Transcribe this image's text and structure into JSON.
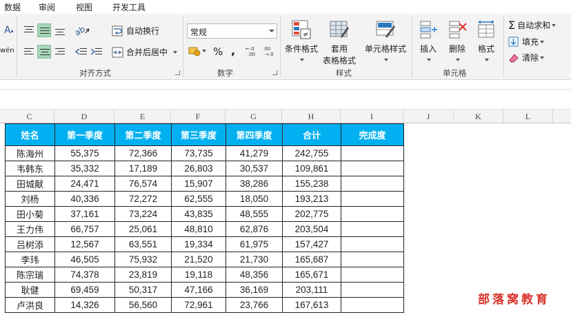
{
  "menu": {
    "tabs": [
      "数据",
      "审阅",
      "视图",
      "开发工具"
    ]
  },
  "ribbon": {
    "alignment": {
      "wrap_text": "自动换行",
      "merge_center": "合并后居中",
      "group_label": "对齐方式"
    },
    "number": {
      "format_value": "常规",
      "percent": "%",
      "comma": ",",
      "group_label": "数字"
    },
    "styles": {
      "conditional_formatting": "条件格式",
      "format_as_table_line1": "套用",
      "format_as_table_line2": "表格格式",
      "cell_styles": "单元格样式",
      "group_label": "样式"
    },
    "cells": {
      "insert": "插入",
      "delete": "删除",
      "format": "格式",
      "group_label": "单元格"
    },
    "editing": {
      "autosum": "自动求和",
      "fill": "填充",
      "clear": "清除"
    },
    "font": {
      "font_glyph": "A",
      "phonetic_glyph": "wén"
    }
  },
  "columns": [
    "C",
    "D",
    "E",
    "F",
    "G",
    "H",
    "I",
    "J",
    "K",
    "L"
  ],
  "table": {
    "headers": [
      "姓名",
      "第一季度",
      "第二季度",
      "第三季度",
      "第四季度",
      "合计",
      "完成度"
    ],
    "rows": [
      [
        "陈海州",
        "55,375",
        "72,366",
        "73,735",
        "41,279",
        "242,755",
        ""
      ],
      [
        "韦韩东",
        "35,332",
        "17,189",
        "26,803",
        "30,537",
        "109,861",
        ""
      ],
      [
        "田城献",
        "24,471",
        "76,574",
        "15,907",
        "38,286",
        "155,238",
        ""
      ],
      [
        "刘杨",
        "40,336",
        "72,272",
        "62,555",
        "18,050",
        "193,213",
        ""
      ],
      [
        "田小菊",
        "37,161",
        "73,224",
        "43,835",
        "48,555",
        "202,775",
        ""
      ],
      [
        "王力伟",
        "66,757",
        "25,061",
        "48,810",
        "62,876",
        "203,504",
        ""
      ],
      [
        "吕树添",
        "12,567",
        "63,551",
        "19,334",
        "61,975",
        "157,427",
        ""
      ],
      [
        "李玮",
        "46,505",
        "75,932",
        "21,520",
        "21,730",
        "165,687",
        ""
      ],
      [
        "陈宗瑞",
        "74,378",
        "23,819",
        "19,118",
        "48,356",
        "165,671",
        ""
      ],
      [
        "耿健",
        "69,459",
        "50,317",
        "47,166",
        "36,169",
        "203,111",
        ""
      ],
      [
        "卢洪良",
        "14,326",
        "56,560",
        "72,961",
        "23,766",
        "167,613",
        ""
      ]
    ]
  },
  "watermark": "部落窝教育",
  "colors": {
    "header_fill": "#00b0f0",
    "header_text": "#ffffff",
    "selected_align": "#a7d8b8",
    "watermark": "#d9342b"
  }
}
